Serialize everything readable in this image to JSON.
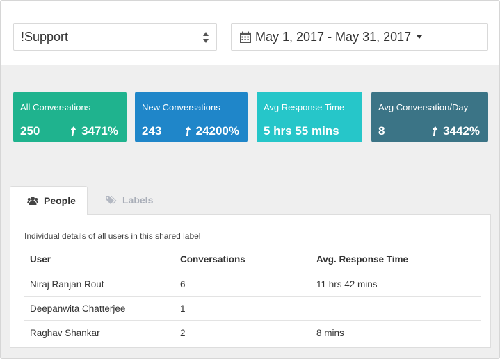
{
  "filters": {
    "label_select": "!Support",
    "date_range": "May 1, 2017 - May 31, 2017"
  },
  "cards": [
    {
      "label": "All Conversations",
      "value": "250",
      "delta": "3471%",
      "color": "#1fb38e"
    },
    {
      "label": "New Conversations",
      "value": "243",
      "delta": "24200%",
      "color": "#1f86c9"
    },
    {
      "label": "Avg Response Time",
      "value": "5 hrs 55 mins",
      "delta": "",
      "color": "#26c6c9"
    },
    {
      "label": "Avg Conversation/Day",
      "value": "8",
      "delta": "3442%",
      "color": "#3b7486"
    }
  ],
  "tabs": {
    "people": "People",
    "labels": "Labels"
  },
  "panel": {
    "description": "Individual details of all users in this shared label",
    "columns": [
      "User",
      "Conversations",
      "Avg. Response Time"
    ],
    "rows": [
      {
        "user": "Niraj Ranjan Rout",
        "conversations": "6",
        "avg_response": "11 hrs 42 mins"
      },
      {
        "user": "Deepanwita Chatterjee",
        "conversations": "1",
        "avg_response": ""
      },
      {
        "user": "Raghav Shankar",
        "conversations": "2",
        "avg_response": "8 mins"
      }
    ]
  },
  "icons": {
    "select_arrows": "sort-arrows-icon",
    "calendar": "calendar-icon",
    "caret": "caret-down-icon",
    "delta_arrow": "arrow-up-icon",
    "people_tab": "users-icon",
    "labels_tab": "tags-icon"
  }
}
